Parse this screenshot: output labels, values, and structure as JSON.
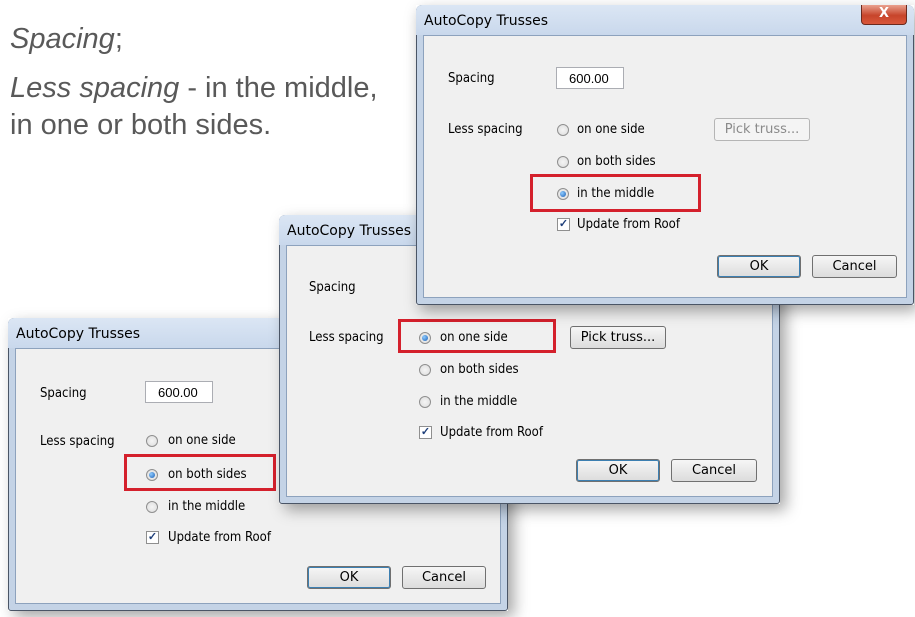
{
  "caption": {
    "line1_italic": "Spacing",
    "line1_rest": ";",
    "line2_italic": "Less spacing",
    "line2_rest": " - in the middle,",
    "line3": "in one or both sides."
  },
  "dialog": {
    "title": "AutoCopy Trusses",
    "close_label": "X",
    "spacing_label": "Spacing",
    "spacing_value": "600.00",
    "less_spacing_label": "Less spacing",
    "option_one_side": "on one side",
    "option_both_sides": "on both sides",
    "option_middle": "in the middle",
    "update_label": "Update from Roof",
    "pick_truss_label": "Pick truss...",
    "ok_label": "OK",
    "cancel_label": "Cancel"
  },
  "dialogs": [
    {
      "id": "top-right",
      "selected": "in the middle",
      "update_checked": true
    },
    {
      "id": "middle",
      "selected": "on one side",
      "update_checked": true
    },
    {
      "id": "bottom-left",
      "selected": "on both sides",
      "update_checked": true
    }
  ],
  "highlight_color": "#d4202c"
}
